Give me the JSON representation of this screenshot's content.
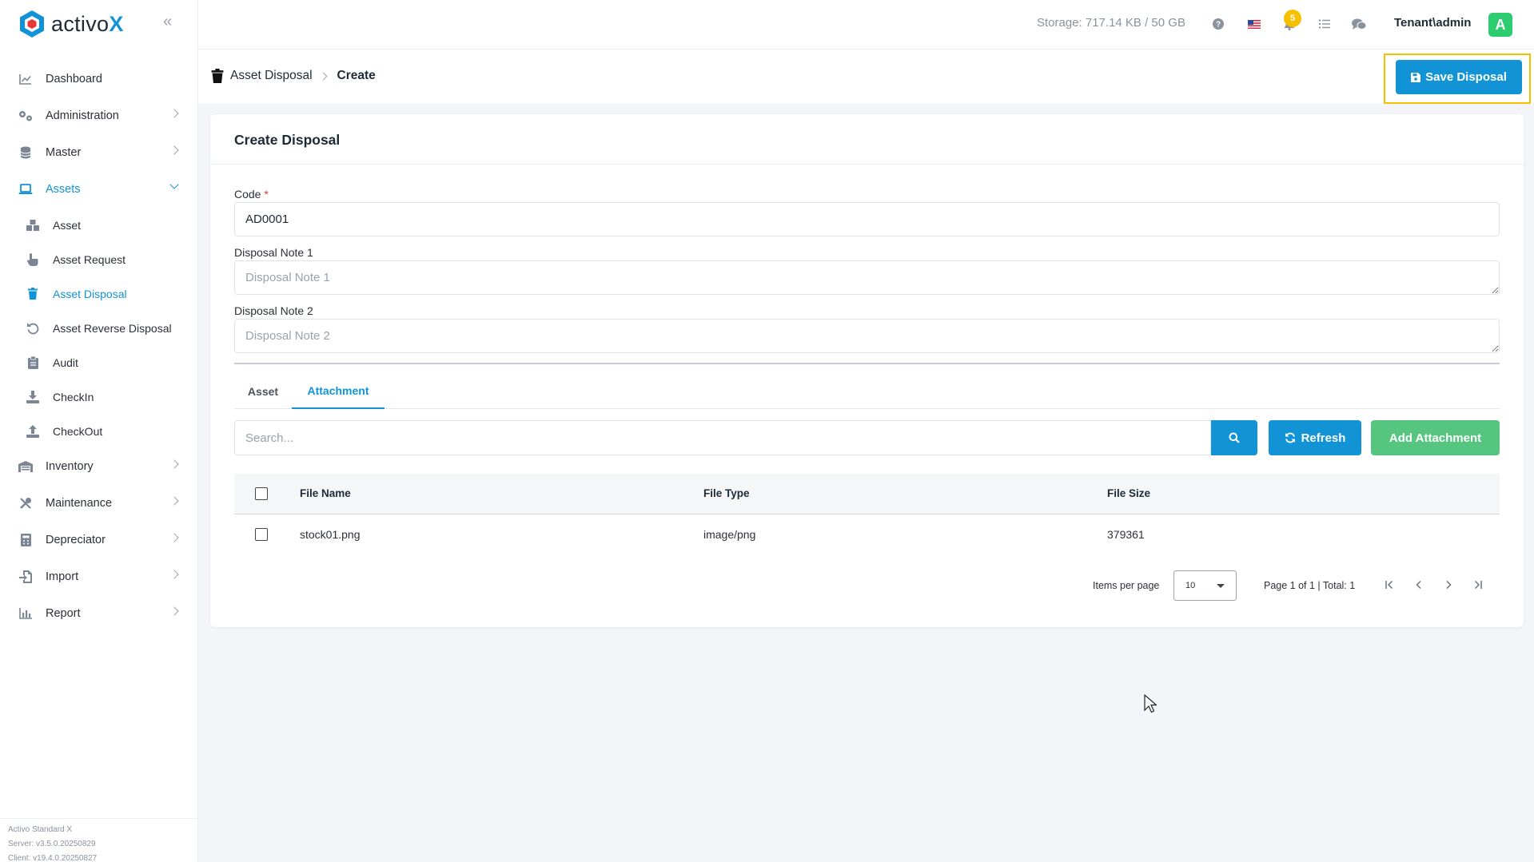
{
  "app": {
    "logo_text": "activo",
    "logo_x": "X",
    "version_line1": "Activo Standard X",
    "version_line2": "Server: v3.5.0.20250829",
    "version_line3": "Client: v19.4.0.20250827"
  },
  "sidebar": {
    "items": [
      {
        "label": "Dashboard"
      },
      {
        "label": "Administration"
      },
      {
        "label": "Master"
      },
      {
        "label": "Assets"
      },
      {
        "label": "Inventory"
      },
      {
        "label": "Maintenance"
      },
      {
        "label": "Depreciator"
      },
      {
        "label": "Import"
      },
      {
        "label": "Report"
      }
    ],
    "asset_sub": [
      {
        "label": "Asset"
      },
      {
        "label": "Asset Request"
      },
      {
        "label": "Asset Disposal"
      },
      {
        "label": "Asset Reverse Disposal"
      },
      {
        "label": "Audit"
      },
      {
        "label": "CheckIn"
      },
      {
        "label": "CheckOut"
      }
    ]
  },
  "topbar": {
    "storage": "Storage: 717.14 KB / 50 GB",
    "notification_count": "5",
    "user": "Tenant\\admin",
    "avatar_letter": "A"
  },
  "header": {
    "breadcrumb_parent": "Asset Disposal",
    "breadcrumb_current": "Create",
    "save_label": "Save Disposal"
  },
  "form": {
    "title": "Create Disposal",
    "code_label": "Code",
    "code_required": "*",
    "code_value": "AD0001",
    "note1_label": "Disposal Note 1",
    "note1_placeholder": "Disposal Note 1",
    "note2_label": "Disposal Note 2",
    "note2_placeholder": "Disposal Note 2"
  },
  "tabs": [
    {
      "label": "Asset"
    },
    {
      "label": "Attachment"
    }
  ],
  "toolbar": {
    "search_placeholder": "Search...",
    "refresh_label": "Refresh",
    "add_label": "Add Attachment"
  },
  "table": {
    "columns": [
      "File Name",
      "File Type",
      "File Size"
    ],
    "rows": [
      {
        "name": "stock01.png",
        "type": "image/png",
        "size": "379361"
      }
    ]
  },
  "pager": {
    "items_per_page_label": "Items per page",
    "items_per_page_value": "10",
    "page_info": "Page 1 of 1 | Total: 1"
  },
  "colors": {
    "accent": "#1193d6",
    "success": "#56c57f",
    "highlight": "#f2c200",
    "badge": "#f6c000",
    "avatar": "#2ecc71"
  }
}
